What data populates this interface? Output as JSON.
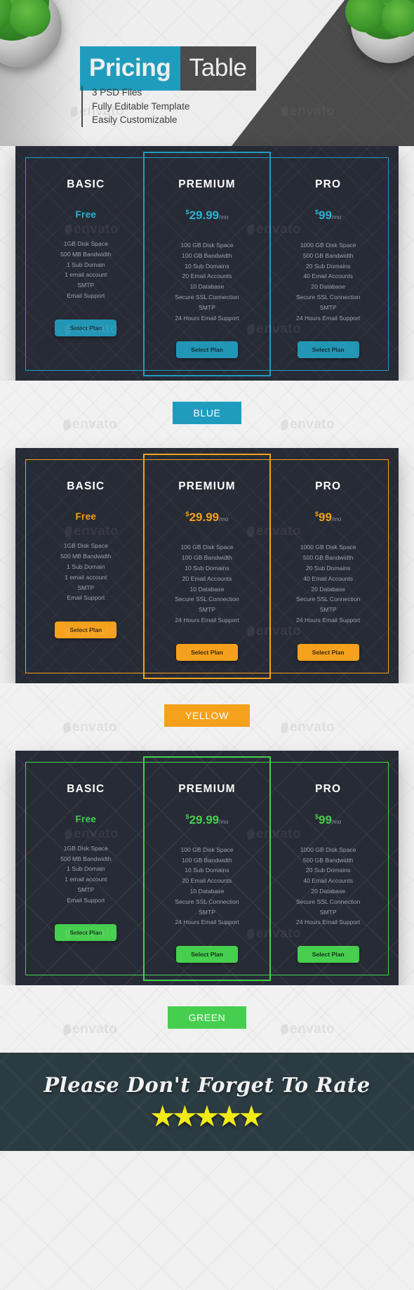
{
  "header": {
    "title_primary": "Pricing",
    "title_secondary": "Table",
    "bullets": [
      "3 PSD Files",
      "Fully Editable Template",
      "Easily Customizable"
    ],
    "accent_color": "#1f9cbd",
    "dark_color": "#4b4b4b"
  },
  "watermark": {
    "text": "envato"
  },
  "plans": {
    "basic": {
      "name": "BASIC",
      "price_currency": "",
      "price_amount": "Free",
      "price_period": "",
      "features": [
        "1GB Disk Space",
        "500 MB Bandwidth",
        "1 Sub Domain",
        "1 email account",
        "SMTP",
        "Email Support"
      ],
      "button": "Select Plan"
    },
    "premium": {
      "name": "PREMIUM",
      "price_currency": "$",
      "price_amount": "29.99",
      "price_period": "/mo",
      "features": [
        "100 GB Disk Space",
        "100 GB Bandwidth",
        "10 Sub Domains",
        "20 Email Accounts",
        "10 Database",
        "Secure SSL Connection",
        "SMTP",
        "24 Hours Email Support"
      ],
      "button": "Select Plan"
    },
    "pro": {
      "name": "PRO",
      "price_currency": "$",
      "price_amount": "99",
      "price_period": "/mo",
      "features": [
        "1000 GB Disk Space",
        "500 GB Bandwidth",
        "20 Sub Domains",
        "40 Email Accounts",
        "20 Database",
        "Secure SSL Connection",
        "SMTP",
        "24 Hours Email Support"
      ],
      "button": "Select Plan"
    }
  },
  "variants": [
    {
      "id": "blue",
      "label": "BLUE",
      "accent": "#1f9cbd",
      "button_bg": "#2196b5",
      "button_text": "#123039",
      "price_color": "#2bb3d6",
      "board_bg": "#272b35"
    },
    {
      "id": "yellow",
      "label": "YELLOW",
      "accent": "#f5a11b",
      "button_bg": "#f5a11b",
      "button_text": "#3a2a06",
      "price_color": "#f5a11b",
      "board_bg": "#272b35"
    },
    {
      "id": "green",
      "label": "GREEN",
      "accent": "#47c council",
      "button_bg": "#46c council",
      "button_text": "#0f3315",
      "price_color": "#46cf4e",
      "board_bg": "#272b35"
    }
  ],
  "footer": {
    "message": "Please Don't Forget To Rate",
    "star_count": 5,
    "star_glyph": "★",
    "star_color": "#f2ea17",
    "background": "#2b3b42"
  }
}
